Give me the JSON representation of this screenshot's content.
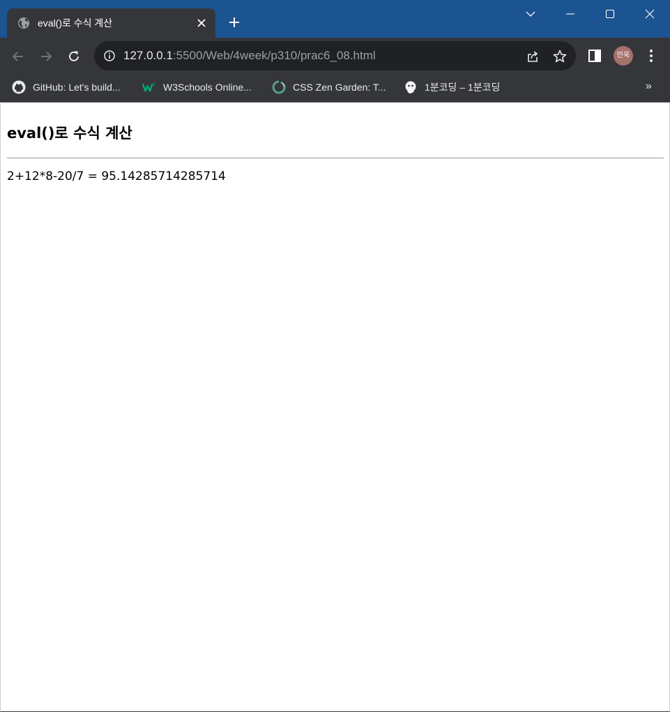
{
  "window": {
    "tab": {
      "title": "eval()로 수식 계산",
      "favicon": "globe-icon"
    },
    "controls": [
      "tab-search-icon",
      "minimize-icon",
      "maximize-icon",
      "close-icon"
    ]
  },
  "toolbar": {
    "url_host": "127.0.0.1",
    "url_path": ":5500/Web/4week/p310/prac6_08.html",
    "profile_initials": "민욱"
  },
  "bookmarks": [
    {
      "label": "GitHub: Let's build...",
      "icon": "github-icon"
    },
    {
      "label": "W3Schools Online...",
      "icon": "w3schools-icon"
    },
    {
      "label": "CSS Zen Garden: T...",
      "icon": "csszengarden-icon"
    },
    {
      "label": "1분코딩 – 1분코딩",
      "icon": "1bun-coding-icon"
    }
  ],
  "bookmarks_more": "»",
  "page": {
    "heading": "eval()로 수식 계산",
    "result": "2+12*8-20/7 = 95.14285714285714"
  },
  "colors": {
    "titlebar": "#1c5391",
    "chrome": "#35363a",
    "omnibox": "#202124",
    "avatar": "#a5716a"
  }
}
